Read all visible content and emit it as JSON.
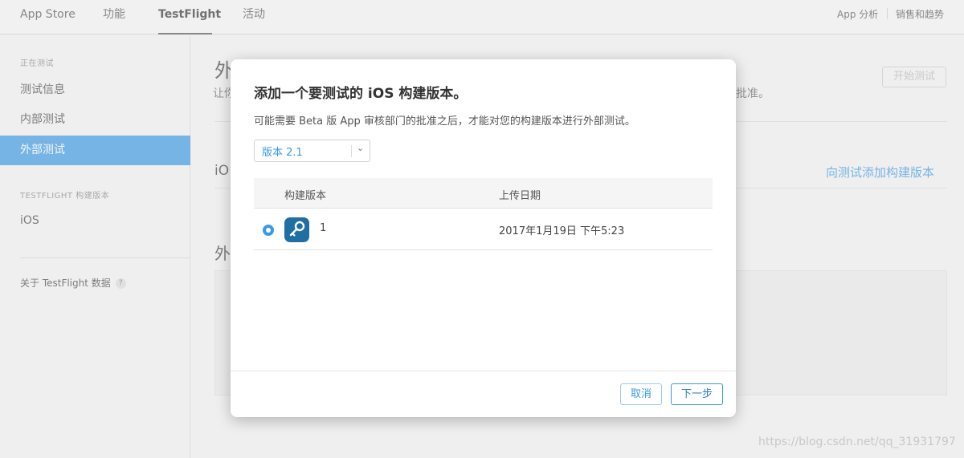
{
  "topnav": {
    "tabs": [
      "App Store",
      "功能",
      "TestFlight",
      "活动"
    ],
    "right_links": [
      "App 分析",
      "销售和趋势"
    ]
  },
  "sidebar": {
    "section_testing": "正在测试",
    "items": [
      "测试信息",
      "内部测试",
      "外部测试"
    ],
    "section_builds": "TESTFLIGHT 构建版本",
    "builds": [
      "iOS"
    ],
    "about": "关于 TestFlight 数据",
    "help": "?"
  },
  "background": {
    "title": "外部测试",
    "subtitle_left": "让你",
    "subtitle_right": "批准。",
    "start_button": "开始测试",
    "ios_label": "iO",
    "add_build_link": "向测试添加构建版本",
    "ext_label": "外"
  },
  "modal": {
    "title": "添加一个要测试的 iOS 构建版本。",
    "description": "可能需要 Beta 版 App 审核部门的批准之后，才能对您的构建版本进行外部测试。",
    "version_select": "版本 2.1",
    "columns": [
      "构建版本",
      "上传日期"
    ],
    "rows": [
      {
        "build": "1",
        "uploaded": "2017年1月19日 下午5:23"
      }
    ],
    "cancel_label": "取消",
    "next_label": "下一步"
  },
  "watermark": "https://blog.csdn.net/qq_31931797"
}
